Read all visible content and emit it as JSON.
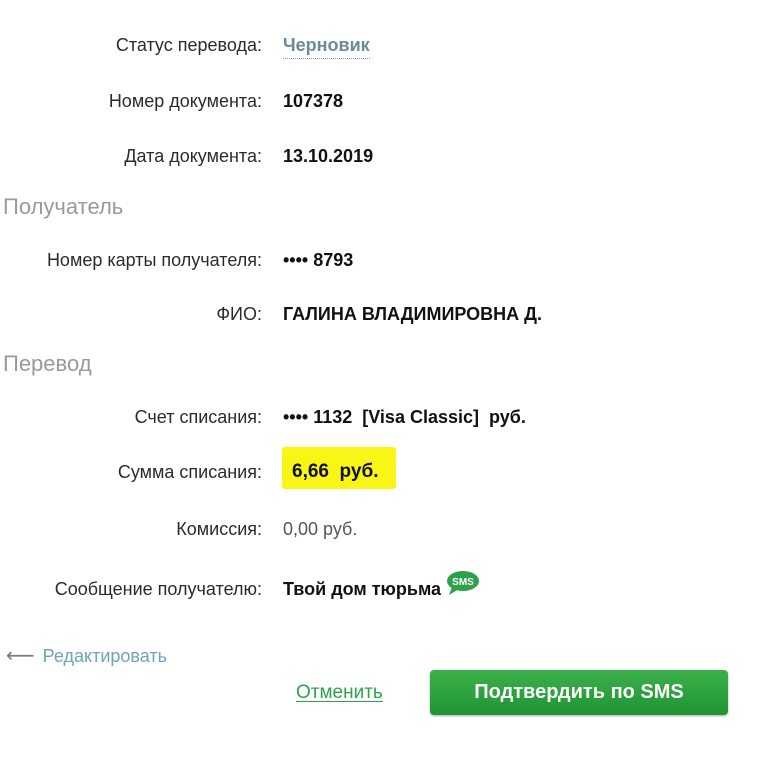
{
  "header_fields": [
    {
      "label": "Статус перевода:",
      "value": "Черновик"
    },
    {
      "label": "Номер документа:",
      "value": "107378"
    },
    {
      "label": "Дата документа:",
      "value": "13.10.2019"
    }
  ],
  "recipient": {
    "section_title": "Получатель",
    "card_label": "Номер карты получателя:",
    "card_value": "•••• 8793",
    "name_label": "ФИО:",
    "name_value": "ГАЛИНА ВЛАДИМИРОВНА Д."
  },
  "transfer": {
    "section_title": "Перевод",
    "account_label": "Счет списания:",
    "account_value": "•••• 1132  [Visa Classic]  руб.",
    "amount_label": "Сумма списания:",
    "amount_value": "6,66  руб.",
    "fee_label": "Комиссия:",
    "fee_value": "0,00 руб.",
    "message_label": "Сообщение получателю:",
    "message_value": "Твой дом тюрьма",
    "sms_badge": "SMS"
  },
  "actions": {
    "edit_label": "Редактировать",
    "cancel_label": "Отменить",
    "confirm_label": "Подтвердить по SMS"
  },
  "colors": {
    "accent_green": "#2ea24b",
    "highlight_yellow": "#f9f517",
    "link_blue": "#6fa3b7",
    "section_gray": "#9a9a9a"
  }
}
